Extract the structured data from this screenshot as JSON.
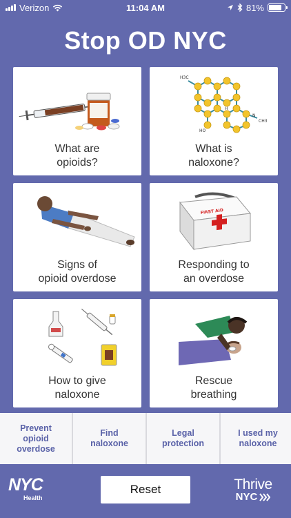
{
  "status_bar": {
    "carrier": "Verizon",
    "time": "11:04 AM",
    "battery": "81%",
    "battery_level": 0.81,
    "icons": [
      "signal-icon",
      "wifi-icon",
      "location-icon",
      "bluetooth-icon",
      "battery-icon"
    ]
  },
  "app": {
    "title": "Stop OD NYC"
  },
  "tiles": [
    {
      "line1": "What are",
      "line2": "opioids?",
      "icon": "syringe-pills-icon"
    },
    {
      "line1": "What is",
      "line2": "naloxone?",
      "icon": "molecule-icon"
    },
    {
      "line1": "Signs of",
      "line2": "opioid overdose",
      "icon": "person-lying-icon"
    },
    {
      "line1": "Responding to",
      "line2": "an overdose",
      "icon": "first-aid-kit-icon"
    },
    {
      "line1": "How to give",
      "line2": "naloxone",
      "icon": "naloxone-kits-icon"
    },
    {
      "line1": "Rescue",
      "line2": "breathing",
      "icon": "rescue-breathing-icon"
    }
  ],
  "first_aid_label": "FIRST AID",
  "molecule_labels": {
    "h3c": "H3C",
    "ho": "HO",
    "h": "H",
    "n": "N",
    "ch3": "CH3"
  },
  "bottom_tabs": [
    {
      "line1": "Prevent",
      "line2": "opioid overdose"
    },
    {
      "line1": "Find",
      "line2": "naloxone"
    },
    {
      "line1": "Legal",
      "line2": "protection"
    },
    {
      "line1": "I used my",
      "line2": "naloxone"
    }
  ],
  "footer": {
    "nyc_logo": "NYC",
    "nyc_sub": "Health",
    "reset_label": "Reset",
    "thrive_top": "Thrive",
    "thrive_bottom": "NYC"
  },
  "colors": {
    "background": "#6269ad",
    "accent_text": "#5a62a8",
    "tile": "#ffffff"
  }
}
